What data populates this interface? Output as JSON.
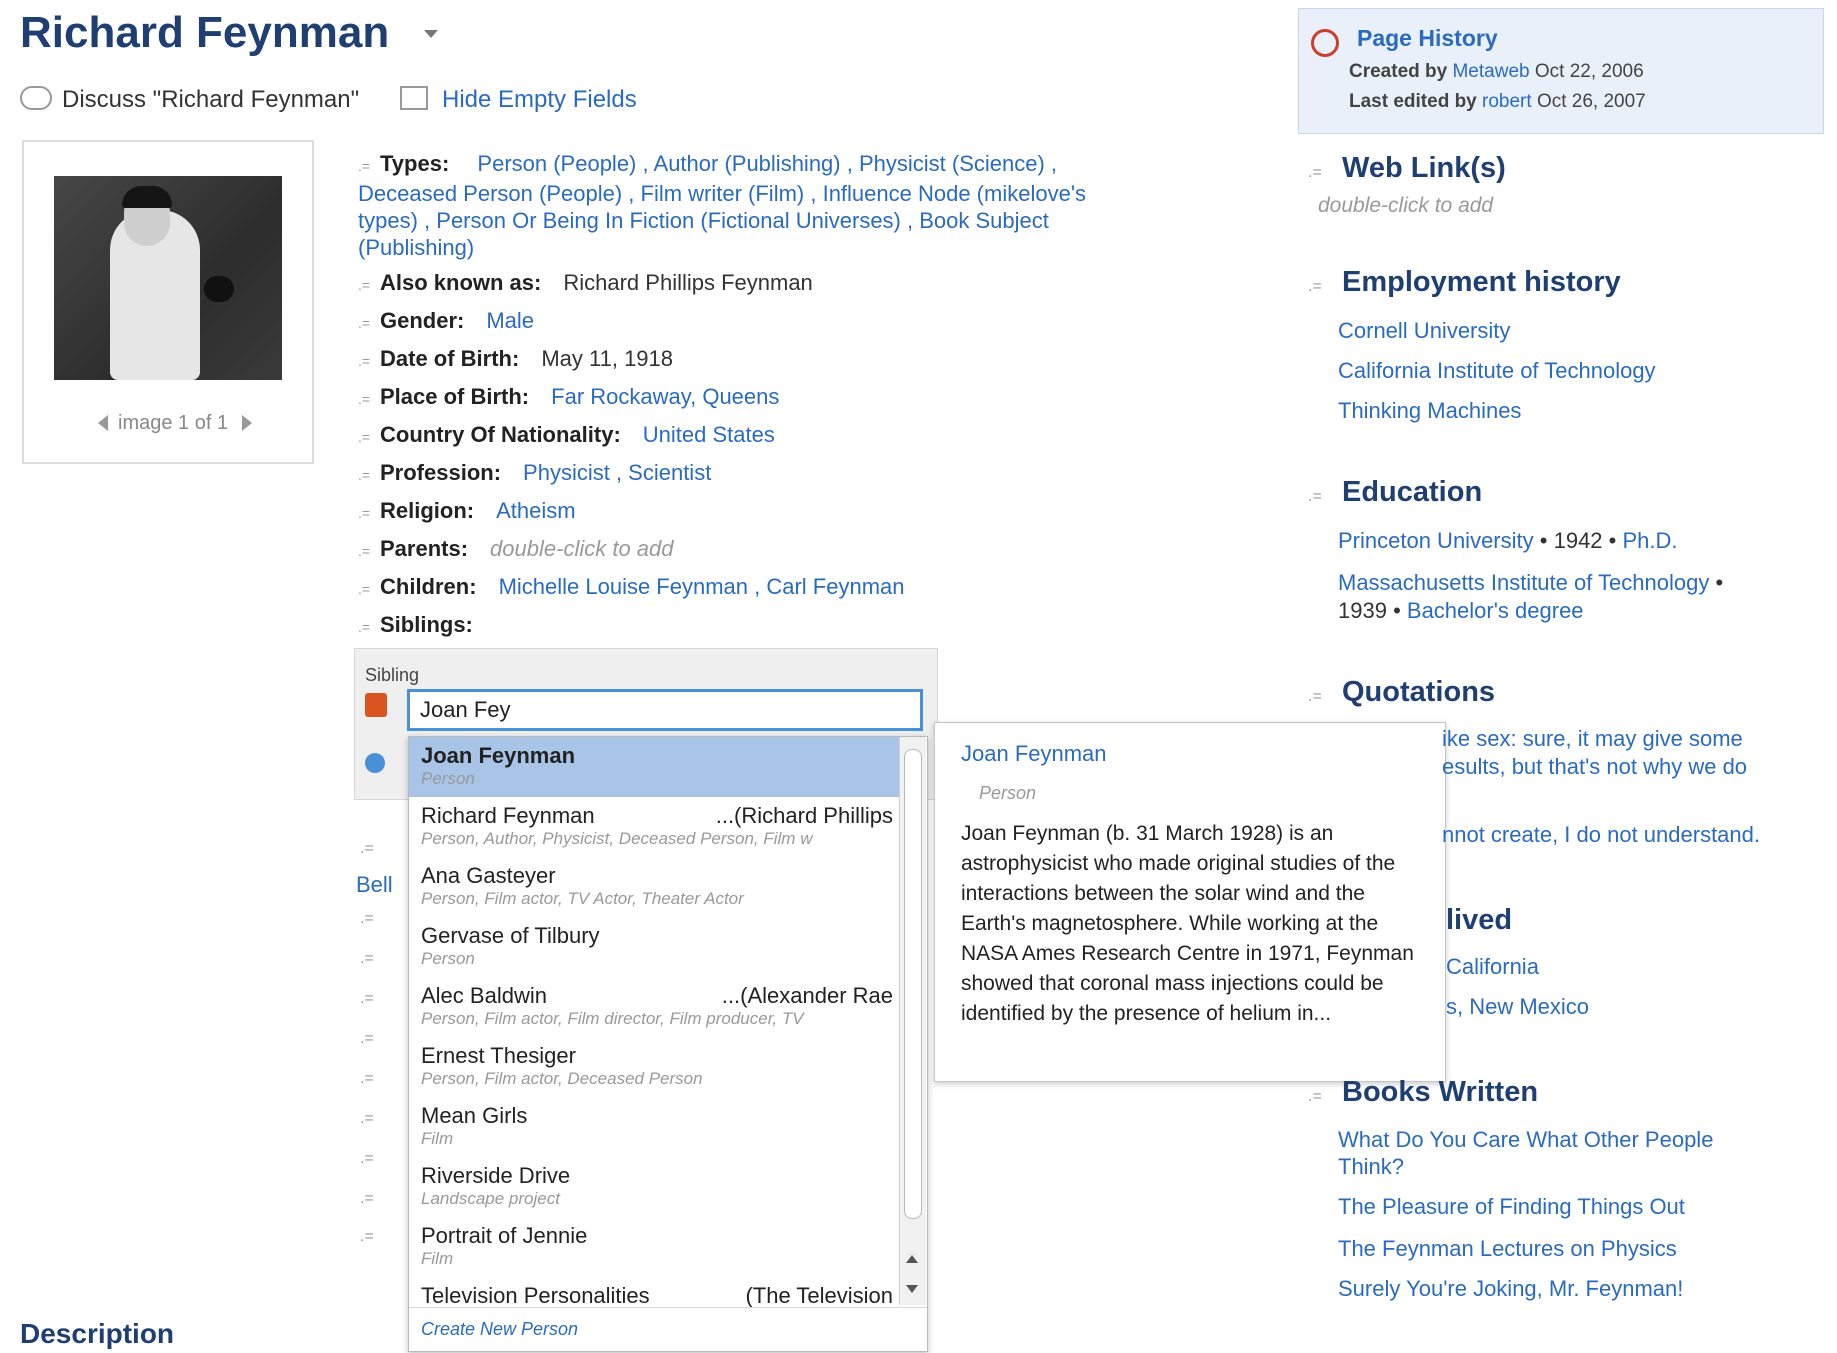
{
  "title": "Richard Feynman",
  "actions": {
    "discuss": "Discuss \"Richard Feynman\"",
    "hide_empty": "Hide Empty Fields"
  },
  "image_nav": "image 1 of 1",
  "types": {
    "label": "Types:",
    "items": [
      "Person (People)",
      "Author (Publishing)",
      "Physicist (Science)",
      "Deceased Person (People)",
      "Film writer (Film)",
      "Influence Node (mikelove's types)",
      "Person Or Being In Fiction (Fictional Universes)",
      "Book Subject (Publishing)"
    ]
  },
  "properties": [
    {
      "label": "Also known as:",
      "value": "Richard Phillips Feynman",
      "kind": "plain"
    },
    {
      "label": "Gender:",
      "value": "Male",
      "kind": "link"
    },
    {
      "label": "Date of Birth:",
      "value": "May 11, 1918",
      "kind": "plain"
    },
    {
      "label": "Place of Birth:",
      "value": "Far Rockaway, Queens",
      "kind": "link"
    },
    {
      "label": "Country Of Nationality:",
      "value": "United States",
      "kind": "link"
    },
    {
      "label": "Profession:",
      "value": "Physicist ,  Scientist",
      "kind": "link"
    },
    {
      "label": "Religion:",
      "value": "Atheism",
      "kind": "link"
    },
    {
      "label": "Parents:",
      "value": "double-click to add",
      "kind": "hint"
    },
    {
      "label": "Children:",
      "value": "Michelle Louise Feynman ,  Carl Feynman",
      "kind": "link"
    },
    {
      "label": "Siblings:",
      "value": "",
      "kind": "plain"
    }
  ],
  "editor": {
    "label": "Sibling",
    "input_value": "Joan Fey"
  },
  "dropdown": {
    "items": [
      {
        "name": "Joan Feynman",
        "alias": "",
        "sub": "Person"
      },
      {
        "name": "Richard Feynman",
        "alias": "...(Richard Phillips",
        "sub": "Person, Author, Physicist, Deceased Person, Film w"
      },
      {
        "name": "Ana Gasteyer",
        "alias": "",
        "sub": "Person, Film actor, TV Actor, Theater Actor"
      },
      {
        "name": "Gervase of Tilbury",
        "alias": "",
        "sub": "Person"
      },
      {
        "name": "Alec Baldwin",
        "alias": "...(Alexander Rae",
        "sub": "Person, Film actor, Film director, Film producer, TV"
      },
      {
        "name": "Ernest Thesiger",
        "alias": "",
        "sub": "Person, Film actor, Deceased Person"
      },
      {
        "name": "Mean Girls",
        "alias": "",
        "sub": "Film"
      },
      {
        "name": "Riverside Drive",
        "alias": "",
        "sub": "Landscape project"
      },
      {
        "name": "Portrait of Jennie",
        "alias": "",
        "sub": "Film"
      },
      {
        "name": "Television Personalities",
        "alias": "(The Television",
        "sub": ""
      }
    ],
    "create": "Create New Person"
  },
  "preview": {
    "name": "Joan Feynman",
    "type": "Person",
    "description": "Joan Feynman (b. 31 March 1928) is an astrophysicist who made original studies of the interactions between the solar wind and the Earth's magnetosphere. While working at the NASA Ames Research Centre in 1971, Feynman showed that coronal mass injections could be identified by the presence of helium in..."
  },
  "history": {
    "title": "Page History",
    "created_label": "Created by",
    "created_by": "Metaweb",
    "created_date": "Oct 22, 2006",
    "edited_label": "Last edited by",
    "edited_by": "robert",
    "edited_date": "Oct 26, 2007"
  },
  "sidebar": {
    "web_links": {
      "title": "Web Link(s)",
      "hint": "double-click to add"
    },
    "employment": {
      "title": "Employment history",
      "items": [
        "Cornell University",
        "California Institute of Technology",
        "Thinking Machines"
      ]
    },
    "education": {
      "title": "Education",
      "row1": {
        "school": "Princeton University",
        "year": "1942",
        "degree": "Ph.D."
      },
      "row2": {
        "school": "Massachusetts Institute of Technology",
        "year": "1939",
        "degree": "Bachelor's degree"
      }
    },
    "quotations": {
      "title": "Quotations",
      "q1": "ike sex: sure, it may give some",
      "q1b": "esults, but that's not why we do",
      "q2": "nnot create, I do not understand."
    },
    "places": {
      "title": "lived",
      "items": [
        "California",
        "s, New Mexico"
      ]
    },
    "books": {
      "title": "Books Written",
      "items": [
        "What Do You Care What Other People Think?",
        "The Pleasure of Finding Things Out",
        "The Feynman Lectures on Physics",
        "Surely You're Joking, Mr. Feynman!"
      ]
    }
  },
  "bell_fragment": "Bell",
  "description_title": "Description"
}
